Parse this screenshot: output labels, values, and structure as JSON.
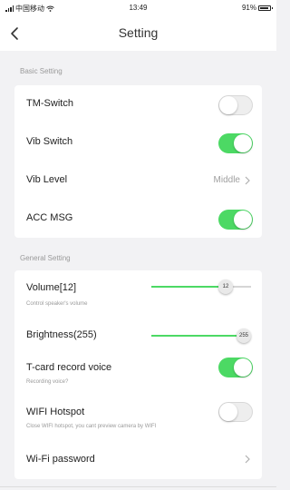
{
  "status_bar": {
    "carrier": "中国移动",
    "time": "13:49",
    "battery": "91%"
  },
  "header": {
    "title": "Setting"
  },
  "basic": {
    "label": "Basic Setting",
    "tm_switch": {
      "label": "TM-Switch",
      "on": false
    },
    "vib_switch": {
      "label": "Vib Switch",
      "on": true
    },
    "vib_level": {
      "label": "Vib Level",
      "value": "Middle"
    },
    "acc_msg": {
      "label": "ACC MSG",
      "on": true
    }
  },
  "general": {
    "label": "General Setting",
    "volume": {
      "label": "Volume[12]",
      "sub": "Control speaker's volume",
      "value": 12,
      "max": 15,
      "thumb": "12"
    },
    "brightness": {
      "label": "Brightness(255)",
      "value": 255,
      "max": 255,
      "thumb": "255"
    },
    "tcard": {
      "label": "T-card record voice",
      "sub": "Recording voice?",
      "on": true
    },
    "wifi_hotspot": {
      "label": "WIFI Hotspot",
      "sub": "Close WIFI hotspot, you cant preview camera by WIFI",
      "on": false
    },
    "wifi_password": {
      "label": "Wi-Fi password"
    }
  },
  "colors": {
    "accent": "#4cd964",
    "toggle_off": "#eeeeee",
    "background": "#f2f2f4"
  }
}
